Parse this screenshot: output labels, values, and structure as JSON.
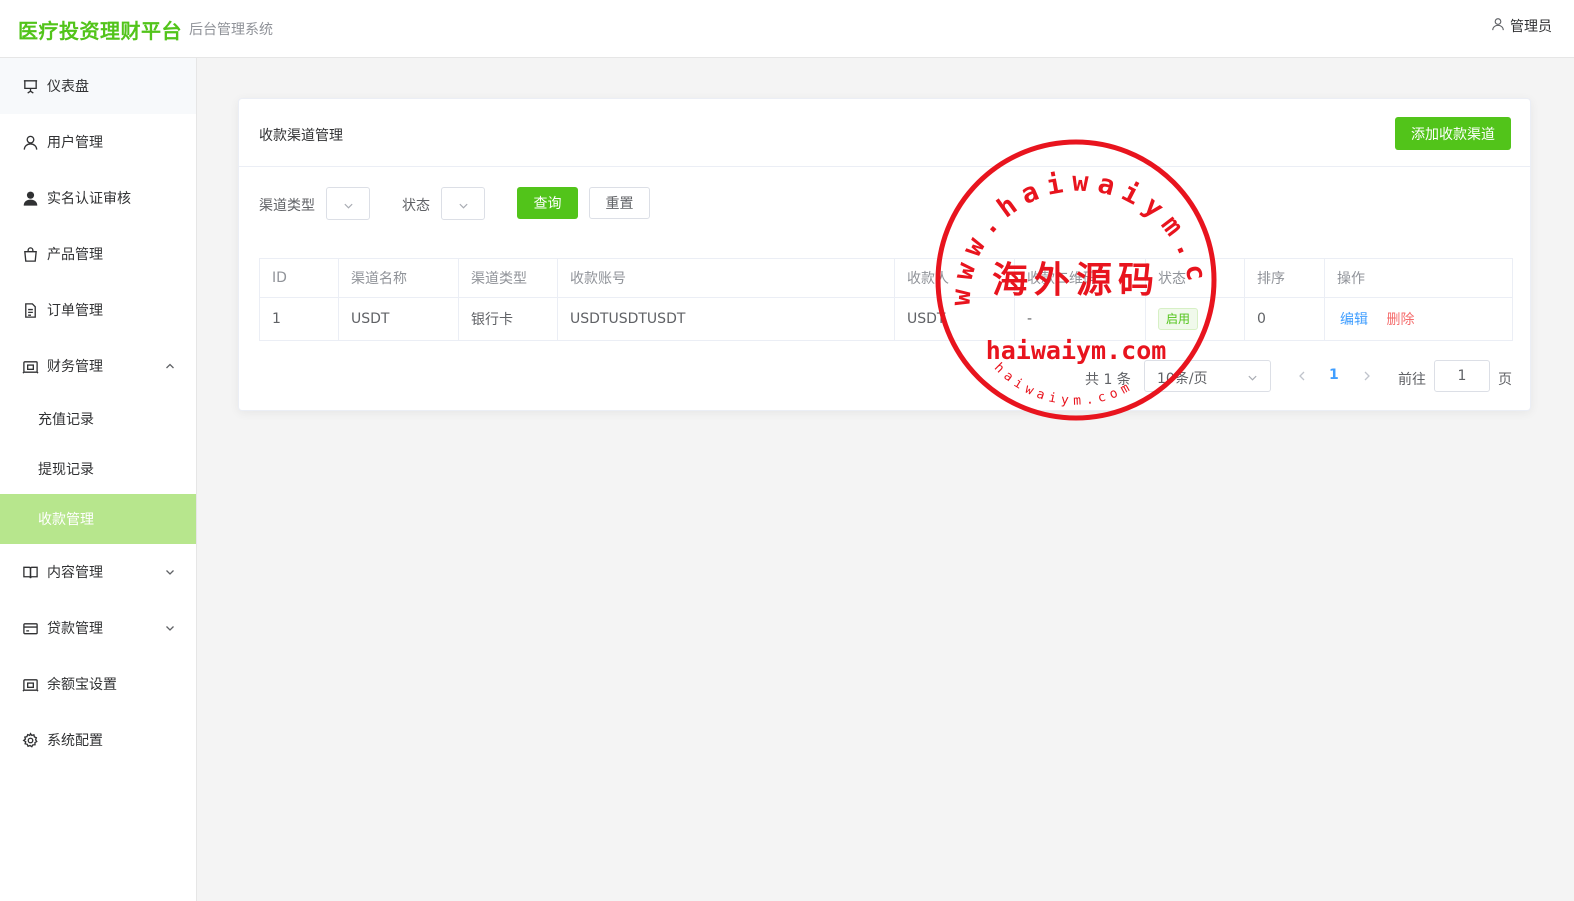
{
  "header": {
    "brand_title": "医疗投资理财平台",
    "brand_subtitle": "后台管理系统",
    "user_name": "管理员"
  },
  "sidebar": {
    "items": [
      {
        "label": "仪表盘",
        "icon": "presentation-board-icon"
      },
      {
        "label": "用户管理",
        "icon": "user-icon"
      },
      {
        "label": "实名认证审核",
        "icon": "user-solid-icon"
      },
      {
        "label": "产品管理",
        "icon": "shopping-bag-icon"
      },
      {
        "label": "订单管理",
        "icon": "document-icon"
      },
      {
        "label": "财务管理",
        "icon": "wallet-icon",
        "expanded": true
      },
      {
        "label": "内容管理",
        "icon": "book-icon"
      },
      {
        "label": "贷款管理",
        "icon": "credit-card-icon"
      },
      {
        "label": "余额宝设置",
        "icon": "wallet-icon"
      },
      {
        "label": "系统配置",
        "icon": "gear-icon"
      }
    ],
    "finance_sub": [
      {
        "label": "充值记录",
        "active": false
      },
      {
        "label": "提现记录",
        "active": false
      },
      {
        "label": "收款管理",
        "active": true
      }
    ]
  },
  "card": {
    "title": "收款渠道管理",
    "add_button": "添加收款渠道"
  },
  "filters": {
    "channel_type_label": "渠道类型",
    "status_label": "状态",
    "query_button": "查询",
    "reset_button": "重置"
  },
  "table": {
    "columns": [
      "ID",
      "渠道名称",
      "渠道类型",
      "收款账号",
      "收款人",
      "收款二维码",
      "状态",
      "排序",
      "操作"
    ],
    "rows": [
      {
        "id": "1",
        "name": "USDT",
        "type": "银行卡",
        "account": "USDTUSDTUSDT",
        "payee": "USDT",
        "qrcode": "-",
        "status": "启用",
        "sort": "0"
      }
    ],
    "actions": {
      "edit": "编辑",
      "delete": "删除"
    }
  },
  "pagination": {
    "total": "共 1 条",
    "page_size": "10条/页",
    "current_page": "1",
    "goto_label": "前往",
    "goto_value": "1",
    "page_suffix": "页"
  },
  "watermark": {
    "arc_text": "www.haiwaiym.com",
    "center_text": "海外源码",
    "sub_text": "haiwaiym.com",
    "bottom_arc_text": "haiwaiym.com",
    "color": "#e8141e"
  },
  "colors": {
    "brand_green": "#52c41a",
    "active_menu_bg": "#b7e68d",
    "link_blue": "#409eff",
    "danger_red": "#f56c6c"
  }
}
